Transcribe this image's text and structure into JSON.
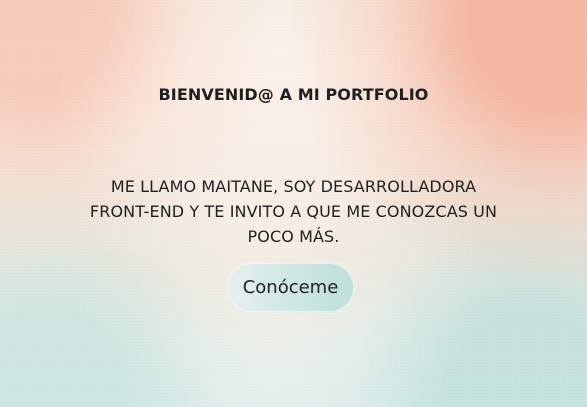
{
  "main": {
    "title": "BIENVENID@ A MI PORTFOLIO",
    "intro": "ME LLAMO MAITANE, SOY DESARROLLADORA FRONT-END Y TE INVITO A QUE ME CONOZCAS UN POCO MÁS.",
    "cta_label": "Conóceme"
  }
}
